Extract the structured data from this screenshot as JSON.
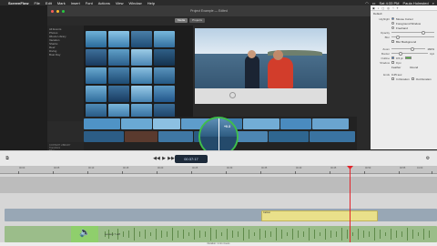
{
  "menubar": {
    "app": "ScreenFlow",
    "items": [
      "File",
      "Edit",
      "Mark",
      "Insert",
      "Font",
      "Actions",
      "View",
      "Window",
      "Help"
    ],
    "clock": "Sat 4:33 PM",
    "user": "Paula Holmsted"
  },
  "imovie": {
    "title": "Project Example — Edited",
    "tabs": [
      "Media",
      "Projects"
    ],
    "sidebar": [
      "All Events",
      "Photos",
      "iMovie Library",
      "Vacation",
      "Sharks",
      "Reef",
      "Diving",
      "Boat Day"
    ],
    "lower_sidebar_header": "CONTENT LIBRARY",
    "lower_sidebar": [
      "Transitions",
      "Titles",
      "Maps & Backgrounds",
      "iTunes",
      "Sound Effects",
      "GarageBand"
    ],
    "zoom_label": "+0.3"
  },
  "inspector": {
    "tabs": [
      "Default"
    ],
    "highlight_label": "Highlight",
    "highlight_options": [
      "Mouse Cursor",
      "Foreground Window",
      "Freehand"
    ],
    "opacity_label": "Opacity",
    "blur_label": "Blur",
    "blur_bg_label": "Blur Background",
    "zoom_label": "Zoom",
    "zoom_value": "160%",
    "border_label": "Border",
    "border_value": "4 pt",
    "outline_label": "Outline",
    "outline_value": "0.5 pt",
    "shadow_label": "Shadow",
    "shadow_value": "0 px",
    "feather_label": "Feather",
    "round_label": "Round",
    "ends_label": "Ends",
    "ends_value": "0.25 sec",
    "in_duration": "In Duration",
    "out_duration": "Out Duration",
    "colors": {
      "outline": "#4fbf3c"
    }
  },
  "transport": {
    "time": "00:37:17"
  },
  "timeline": {
    "ruler_labels": [
      "00:00",
      "00:05",
      "00:10",
      "00:15",
      "00:20",
      "00:25",
      "00:30",
      "00:35",
      "00:40",
      "00:45",
      "00:50",
      "00:55",
      "01:00"
    ],
    "yellow_clip_label": "Callout",
    "audio_label": "Lesson 7.aiff",
    "status": "Duration: 1 min 4 secs"
  }
}
